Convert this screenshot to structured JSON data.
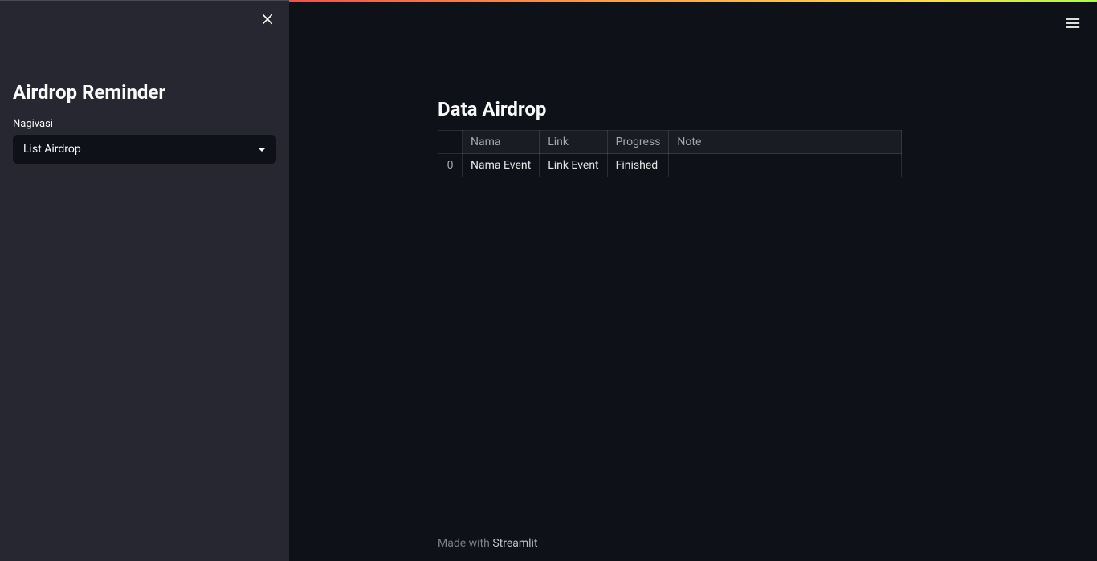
{
  "sidebar": {
    "title": "Airdrop Reminder",
    "nav_label": "Nagivasi",
    "nav_selected": "List Airdrop"
  },
  "main": {
    "heading": "Data Airdrop",
    "table": {
      "columns": [
        "Nama",
        "Link",
        "Progress",
        "Note"
      ],
      "rows": [
        {
          "idx": "0",
          "Nama": "Nama Event",
          "Link": "Link Event",
          "Progress": "Finished",
          "Note": ""
        }
      ]
    }
  },
  "footer": {
    "prefix": "Made with ",
    "brand": "Streamlit"
  }
}
